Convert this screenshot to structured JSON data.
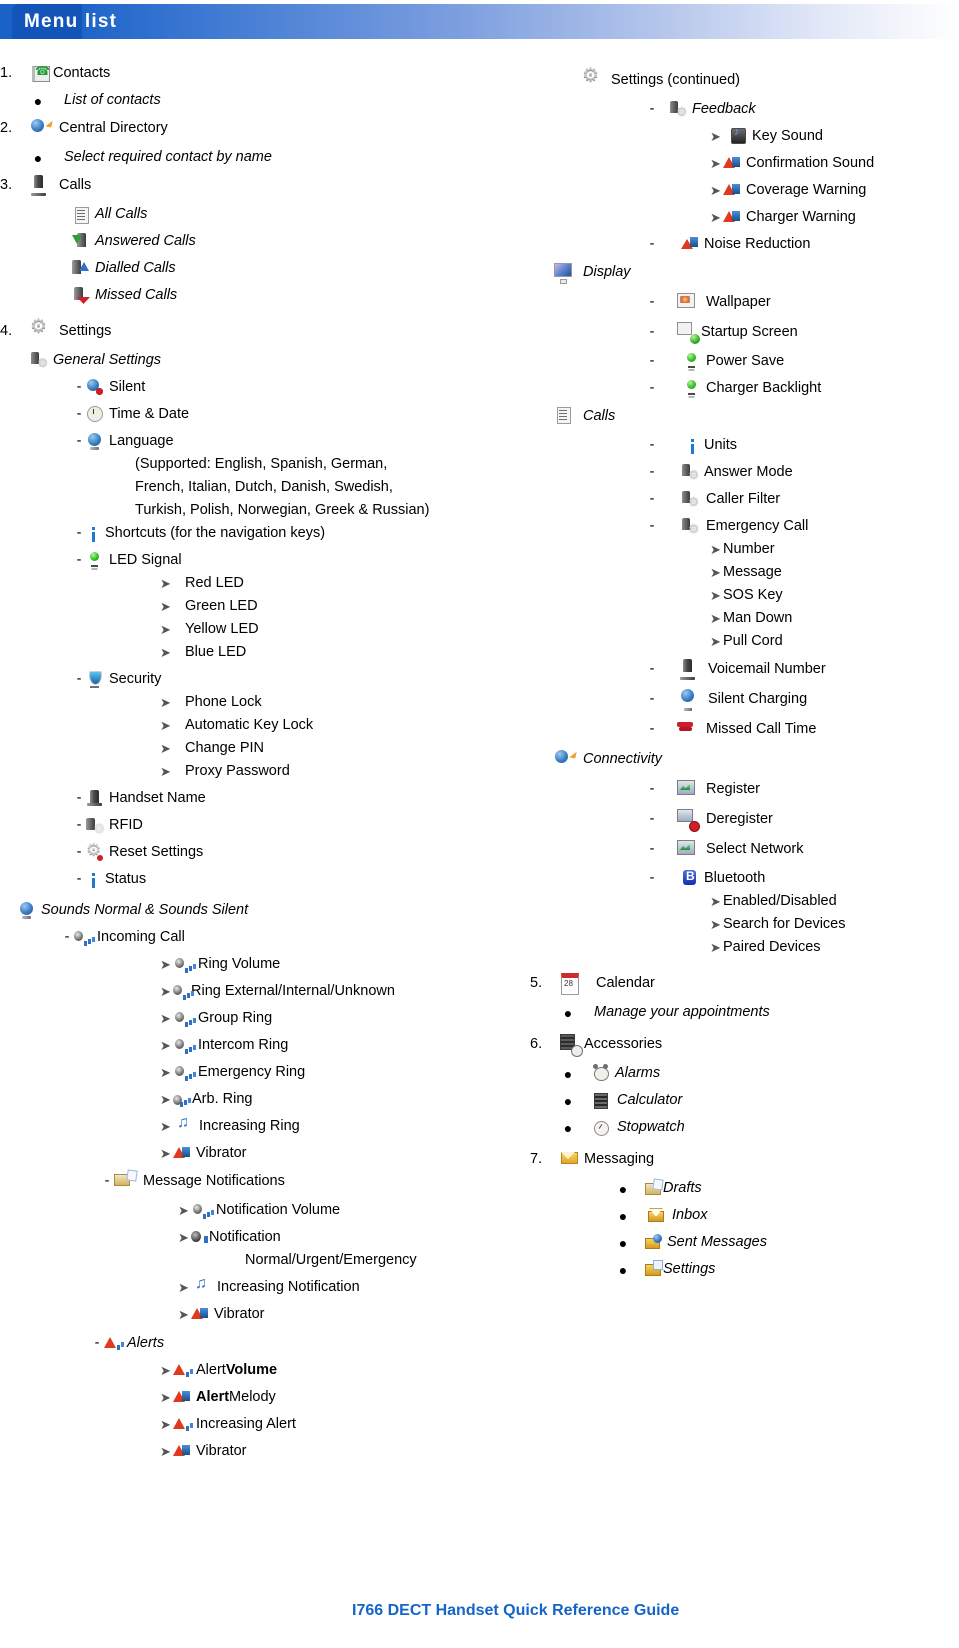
{
  "header": {
    "title": "Menu list"
  },
  "footer": {
    "text": "I766 DECT Handset Quick Reference Guide"
  },
  "left_column": {
    "item1": {
      "number": "1.",
      "label": "Contacts",
      "icon": "contacts-book-icon",
      "sub": [
        {
          "bullet": "●",
          "label": "List of contacts"
        }
      ]
    },
    "item2": {
      "number": "2.",
      "label": "Central Directory",
      "icon": "globe-arrow-icon",
      "sub": [
        {
          "bullet": "●",
          "label": "Select required contact by name"
        }
      ]
    },
    "item3": {
      "number": "3.",
      "label": "Calls",
      "icon": "handset-icon",
      "sub": [
        {
          "label": "All Calls",
          "icon": "call-list-icon"
        },
        {
          "label": "Answered Calls",
          "icon": "answered-call-icon"
        },
        {
          "label": "Dialled Calls",
          "icon": "dialled-call-icon"
        },
        {
          "label": "Missed Calls",
          "icon": "missed-call-icon"
        }
      ]
    },
    "item4": {
      "number": "4.",
      "label": "Settings",
      "icon": "gear-icon",
      "general_settings": {
        "label": "General Settings",
        "icon": "handset-gear-icon",
        "items": [
          {
            "dash": "-",
            "label": "Silent",
            "icon": "silent-icon"
          },
          {
            "dash": "-",
            "label": "Time & Date",
            "icon": "clock-icon"
          },
          {
            "dash": "-",
            "label": "Language",
            "icon": "globe-icon"
          }
        ],
        "language_note_line1": "(Supported: English, Spanish, German,",
        "language_note_line2": "French, Italian, Dutch, Danish, Swedish,",
        "language_note_line3": "Turkish, Polish, Norwegian, Greek & Russian)",
        "shortcuts": {
          "dash": "-",
          "label": "Shortcuts (for the navigation keys)",
          "icon": "info-icon"
        },
        "led_signal": {
          "dash": "-",
          "label": "LED Signal",
          "icon": "led-icon"
        },
        "led_children": [
          {
            "arrow": "➤",
            "label": "Red LED"
          },
          {
            "arrow": "➤",
            "label": "Green LED"
          },
          {
            "arrow": "➤",
            "label": "Yellow LED"
          },
          {
            "arrow": "➤",
            "label": "Blue LED"
          }
        ],
        "security": {
          "dash": "-",
          "label": "Security",
          "icon": "shield-icon"
        },
        "security_children": [
          {
            "arrow": "➤",
            "label": "Phone Lock"
          },
          {
            "arrow": "➤",
            "label": "Automatic Key Lock"
          },
          {
            "arrow": "➤",
            "label": "Change PIN"
          },
          {
            "arrow": "➤",
            "label": "Proxy Password"
          }
        ],
        "tail": [
          {
            "dash": "-",
            "label": "Handset Name",
            "icon": "handset-icon"
          },
          {
            "dash": "-",
            "label": "RFID",
            "icon": "rfid-icon"
          },
          {
            "dash": "-",
            "label": "Reset Settings",
            "icon": "reset-icon"
          },
          {
            "dash": "-",
            "label": "Status",
            "icon": "info-icon"
          }
        ]
      },
      "sounds": {
        "label": "Sounds Normal & Sounds Silent",
        "icon": "sound-globe-icon",
        "incoming_call": {
          "dash": "-",
          "label": "Incoming Call",
          "icon": "volume-icon"
        },
        "incoming_children": [
          {
            "arrow": "➤",
            "label": "Ring Volume",
            "icon": "volume-icon"
          },
          {
            "arrow": "➤",
            "label": "Ring External/Internal/Unknown",
            "icon": "volume-icon"
          },
          {
            "arrow": "➤",
            "label": "Group Ring",
            "icon": "volume-icon"
          },
          {
            "arrow": "➤",
            "label": "Intercom Ring",
            "icon": "volume-icon"
          },
          {
            "arrow": "➤",
            "label": "Emergency Ring",
            "icon": "volume-icon"
          },
          {
            "arrow": "➤",
            "label": "Arb. Ring",
            "icon": "volume-small-icon"
          },
          {
            "arrow": "➤",
            "label": "Increasing Ring",
            "icon": "music-note-icon"
          },
          {
            "arrow": "➤",
            "label": "Vibrator",
            "icon": "warning-note-icon"
          }
        ],
        "message_notifications": {
          "dash": "-",
          "label": "Message Notifications",
          "icon": "message-note-icon"
        },
        "message_children": [
          {
            "arrow": "➤",
            "label": "Notification Volume",
            "icon": "volume-icon"
          },
          {
            "arrow": "➤",
            "label": "Notification",
            "icon": "notification-sound-icon"
          }
        ],
        "notification_modes": "Normal/Urgent/Emergency",
        "message_children2": [
          {
            "arrow": "➤",
            "label": "Increasing Notification",
            "icon": "music-note-icon"
          },
          {
            "arrow": "➤",
            "label": "Vibrator",
            "icon": "warning-note-icon"
          }
        ],
        "alerts": {
          "dash": "-",
          "label": "Alerts",
          "icon": "warning-bars-icon"
        },
        "alerts_children": [
          {
            "arrow": "➤",
            "pre": "Alert ",
            "bold": "Volume",
            "post": "",
            "icon": "warning-bars-icon"
          },
          {
            "arrow": "➤",
            "pre": "",
            "bold": "Alert",
            "post": " Melody",
            "icon": "warning-note-icon"
          },
          {
            "arrow": "➤",
            "pre": "Increasing Alert",
            "bold": "",
            "post": "",
            "icon": "warning-bars-icon"
          },
          {
            "arrow": "➤",
            "pre": "Vibrator",
            "bold": "",
            "post": "",
            "icon": "warning-note-icon"
          }
        ]
      }
    }
  },
  "right_column": {
    "settings_continued": {
      "label": "Settings (continued)",
      "icon": "gear-icon",
      "feedback": {
        "dash": "-",
        "label": "Feedback",
        "icon": "handset-gear-icon"
      },
      "feedback_children": [
        {
          "arrow": "➤",
          "label": "Key Sound",
          "icon": "key-sound-icon"
        },
        {
          "arrow": "➤",
          "label": "Confirmation Sound",
          "icon": "warning-note-icon"
        },
        {
          "arrow": "➤",
          "label": "Coverage Warning",
          "icon": "warning-note-icon"
        },
        {
          "arrow": "➤",
          "label": "Charger Warning",
          "icon": "warning-note-icon"
        }
      ],
      "noise_reduction": {
        "dash": "-",
        "label": "Noise Reduction",
        "icon": "noise-reduction-icon"
      }
    },
    "display": {
      "label": "Display",
      "icon": "display-icon",
      "items": [
        {
          "dash": "-",
          "label": "Wallpaper",
          "icon": "wallpaper-icon"
        },
        {
          "dash": "-",
          "label": "Startup Screen",
          "icon": "startup-screen-icon"
        },
        {
          "dash": "-",
          "label": "Power Save",
          "icon": "led-icon"
        },
        {
          "dash": "-",
          "label": "Charger Backlight",
          "icon": "led-icon"
        }
      ]
    },
    "calls": {
      "label": "Calls",
      "icon": "call-list-icon",
      "items": [
        {
          "dash": "-",
          "label": "Units",
          "icon": "info-icon"
        },
        {
          "dash": "-",
          "label": "Answer Mode",
          "icon": "handset-gear-icon"
        },
        {
          "dash": "-",
          "label": "Caller Filter",
          "icon": "handset-gear-icon"
        },
        {
          "dash": "-",
          "label": "Emergency Call",
          "icon": "handset-gear-icon"
        }
      ],
      "emergency_children": [
        {
          "arrow": "➤",
          "label": "Number"
        },
        {
          "arrow": "➤",
          "label": "Message"
        },
        {
          "arrow": "➤",
          "label": "SOS Key"
        },
        {
          "arrow": "➤",
          "label": "Man Down"
        },
        {
          "arrow": "➤",
          "label": "Pull Cord"
        }
      ],
      "tail": [
        {
          "dash": "-",
          "label": "Voicemail Number",
          "icon": "handset-icon"
        },
        {
          "dash": "-",
          "label": "Silent Charging",
          "icon": "silent-charging-icon"
        },
        {
          "dash": "-",
          "label": "Missed Call Time",
          "icon": "missed-call-time-icon"
        }
      ]
    },
    "connectivity": {
      "label": "Connectivity",
      "icon": "globe-arrow-icon",
      "items": [
        {
          "dash": "-",
          "label": "Register",
          "icon": "network-icon"
        },
        {
          "dash": "-",
          "label": "Deregister",
          "icon": "deregister-icon"
        },
        {
          "dash": "-",
          "label": "Select Network",
          "icon": "network-icon"
        },
        {
          "dash": "-",
          "label": "Bluetooth",
          "icon": "bluetooth-icon"
        }
      ],
      "bluetooth_children": [
        {
          "arrow": "➤",
          "label": "Enabled/Disabled"
        },
        {
          "arrow": "➤",
          "label": "Search for Devices"
        },
        {
          "arrow": "➤",
          "label": "Paired Devices"
        }
      ]
    },
    "item5": {
      "number": "5.",
      "label": "Calendar",
      "icon": "calendar-icon",
      "sub": [
        {
          "bullet": "●",
          "label": "Manage your appointments"
        }
      ]
    },
    "item6": {
      "number": "6.",
      "label": "Accessories",
      "icon": "accessories-icon",
      "sub": [
        {
          "bullet": "●",
          "label": "Alarms",
          "icon": "alarm-clock-icon"
        },
        {
          "bullet": "●",
          "label": "Calculator",
          "icon": "calculator-icon"
        },
        {
          "bullet": "●",
          "label": "Stopwatch",
          "icon": "stopwatch-icon"
        }
      ]
    },
    "item7": {
      "number": "7.",
      "label": "Messaging",
      "icon": "envelope-icon",
      "sub": [
        {
          "bullet": "●",
          "label": "Drafts",
          "icon": "drafts-icon"
        },
        {
          "bullet": "●",
          "label": "Inbox",
          "icon": "inbox-icon"
        },
        {
          "bullet": "●",
          "label": "Sent Messages",
          "icon": "sent-messages-icon"
        },
        {
          "bullet": "●",
          "label": "Settings",
          "icon": "message-settings-icon"
        }
      ]
    }
  }
}
